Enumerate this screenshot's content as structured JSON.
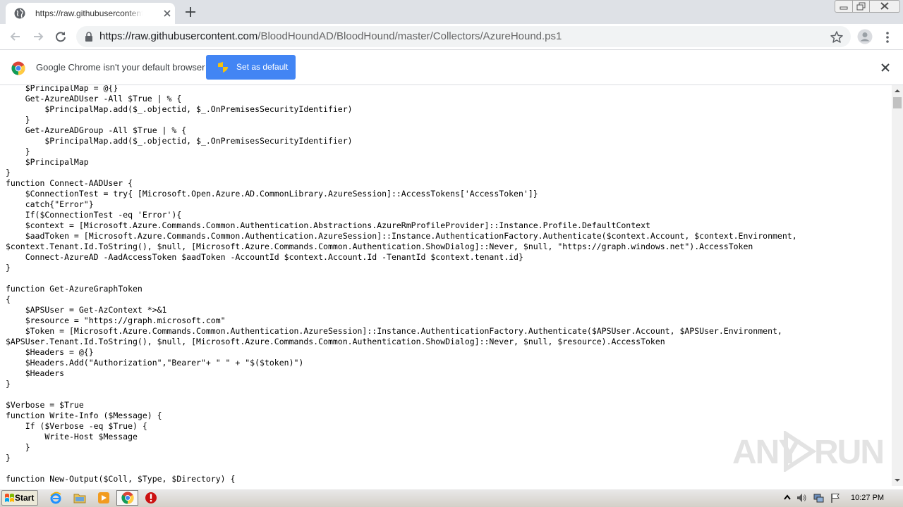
{
  "browser": {
    "tab_title": "https://raw.githubusercontent.com/",
    "url_host": "https://raw.githubusercontent.com",
    "url_path": "/BloodHoundAD/BloodHound/master/Collectors/AzureHound.ps1"
  },
  "infobar": {
    "message": "Google Chrome isn't your default browser",
    "button_label": "Set as default"
  },
  "code": {
    "text": "    $PrincipalMap = @{}\n    Get-AzureADUser -All $True | % {\n        $PrincipalMap.add($_.objectid, $_.OnPremisesSecurityIdentifier)\n    }\n    Get-AzureADGroup -All $True | % {\n        $PrincipalMap.add($_.objectid, $_.OnPremisesSecurityIdentifier)\n    }\n    $PrincipalMap\n}\nfunction Connect-AADUser {\n    $ConnectionTest = try{ [Microsoft.Open.Azure.AD.CommonLibrary.AzureSession]::AccessTokens['AccessToken']}\n    catch{\"Error\"}\n    If($ConnectionTest -eq 'Error'){\n    $context = [Microsoft.Azure.Commands.Common.Authentication.Abstractions.AzureRmProfileProvider]::Instance.Profile.DefaultContext\n    $aadToken = [Microsoft.Azure.Commands.Common.Authentication.AzureSession]::Instance.AuthenticationFactory.Authenticate($context.Account, $context.Environment,\n$context.Tenant.Id.ToString(), $null, [Microsoft.Azure.Commands.Common.Authentication.ShowDialog]::Never, $null, \"https://graph.windows.net\").AccessToken\n    Connect-AzureAD -AadAccessToken $aadToken -AccountId $context.Account.Id -TenantId $context.tenant.id}\n}\n\nfunction Get-AzureGraphToken\n{\n    $APSUser = Get-AzContext *>&1\n    $resource = \"https://graph.microsoft.com\"\n    $Token = [Microsoft.Azure.Commands.Common.Authentication.AzureSession]::Instance.AuthenticationFactory.Authenticate($APSUser.Account, $APSUser.Environment,\n$APSUser.Tenant.Id.ToString(), $null, [Microsoft.Azure.Commands.Common.Authentication.ShowDialog]::Never, $null, $resource).AccessToken\n    $Headers = @{}\n    $Headers.Add(\"Authorization\",\"Bearer\"+ \" \" + \"$($token)\")\n    $Headers\n}\n\n$Verbose = $True\nfunction Write-Info ($Message) {\n    If ($Verbose -eq $True) {\n        Write-Host $Message\n    }\n}\n\nfunction New-Output($Coll, $Type, $Directory) {"
  },
  "watermark": {
    "left_text": "ANY",
    "right_text": "RUN"
  },
  "taskbar": {
    "start_label": "Start",
    "clock": "10:27 PM"
  },
  "colors": {
    "accent_blue": "#4285f4",
    "tab_strip": "#dee1e6",
    "omnibox": "#f1f3f4"
  },
  "icons": [
    "globe-icon",
    "close-icon",
    "plus-icon",
    "back-icon",
    "forward-icon",
    "reload-icon",
    "lock-icon",
    "star-icon",
    "profile-icon",
    "menu-icon",
    "chrome-logo-icon",
    "shield-icon",
    "ie-icon",
    "folder-icon",
    "media-player-icon",
    "chrome-icon",
    "stop-icon"
  ]
}
